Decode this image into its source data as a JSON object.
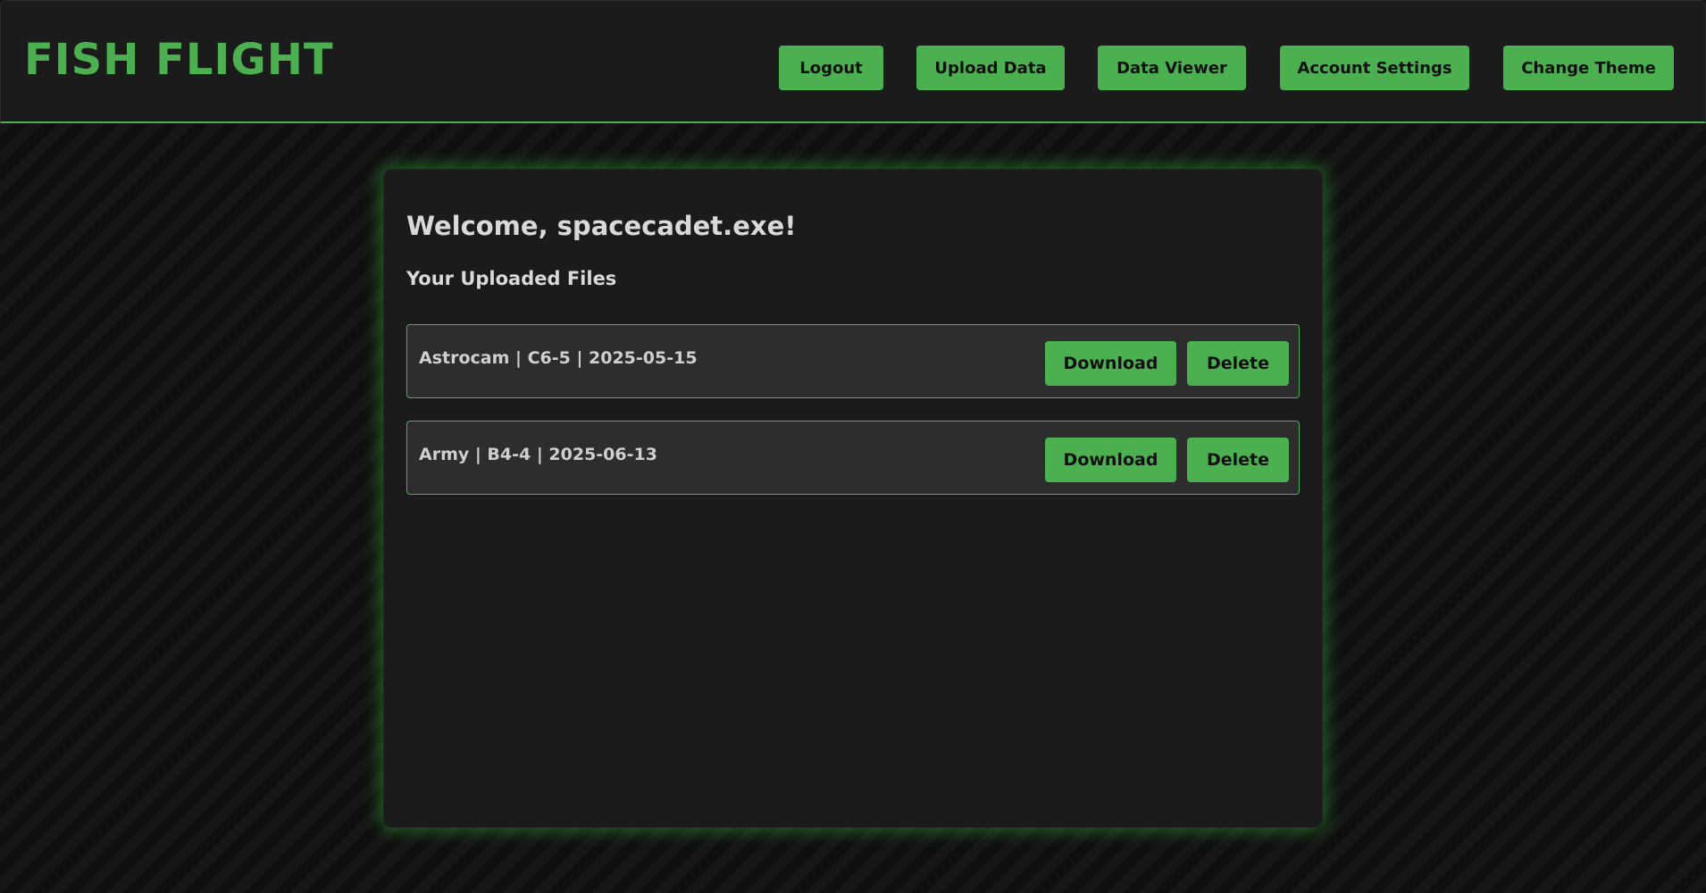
{
  "header": {
    "brand": "FISH FLIGHT",
    "nav": {
      "logout": "Logout",
      "upload": "Upload Data",
      "viewer": "Data Viewer",
      "account": "Account Settings",
      "theme": "Change Theme"
    }
  },
  "main": {
    "welcome": "Welcome, spacecadet.exe!",
    "section_title": "Your Uploaded Files",
    "files": [
      {
        "label": "Astrocam | C6-5 | 2025-05-15",
        "download": "Download",
        "delete": "Delete"
      },
      {
        "label": "Army | B4-4 | 2025-06-13",
        "download": "Download",
        "delete": "Delete"
      }
    ]
  },
  "colors": {
    "accent": "#4caf50",
    "background": "#121212",
    "panel": "#1b1b1b",
    "row": "#2d2d2d",
    "text": "#d9d9d9"
  }
}
